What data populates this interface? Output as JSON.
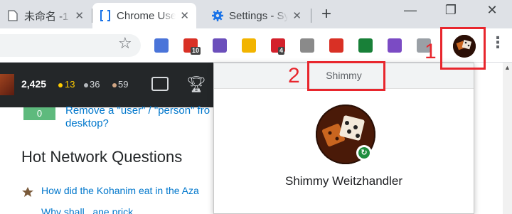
{
  "tabs": [
    {
      "title": "未命名 -1",
      "icon": "document-icon"
    },
    {
      "title": "Chrome Users",
      "icon": "bracket-page-icon",
      "active": true
    },
    {
      "title": "Settings - Sync",
      "icon": "gear-icon"
    }
  ],
  "toolbar": {
    "extensions": [
      {
        "name": "translate-extension-icon",
        "color": "#4a74d9"
      },
      {
        "name": "gmail-extension-icon",
        "color": "#d93025",
        "badge": "10"
      },
      {
        "name": "ve-extension-icon",
        "color": "#6b4fbb"
      },
      {
        "name": "onetab-extension-icon",
        "color": "#f2b400"
      },
      {
        "name": "opera-extension-icon",
        "color": "#d3212b",
        "badge": "4"
      },
      {
        "name": "window-extension-icon",
        "color": "#8a8a8a"
      },
      {
        "name": "flag-extension-icon",
        "color": "#d93025"
      },
      {
        "name": "shield-check-extension-icon",
        "color": "#188038"
      },
      {
        "name": "visual-studio-extension-icon",
        "color": "#7b4bc4"
      },
      {
        "name": "hexagon-extension-icon",
        "color": "#9aa0a6"
      }
    ]
  },
  "page": {
    "reputation": "2,425",
    "gold": "13",
    "silver": "36",
    "bronze": "59",
    "vote_count": "0",
    "answer_link_line1": "Remove a \"user\" / \"person\" fro",
    "answer_link_line2": "desktop?",
    "hot_network_heading": "Hot Network Questions",
    "question_1": "How did the Kohanim eat in the Aza",
    "question_2": "Why shall...ane prick..."
  },
  "profile_popup": {
    "header_name": "Shimmy",
    "full_name": "Shimmy Weitzhandler"
  },
  "annotations": {
    "label_1": "1",
    "label_2": "2"
  },
  "colors": {
    "annotation_red": "#e8262d",
    "sync_green": "#1e8e3e",
    "link_blue": "#0077cc"
  }
}
